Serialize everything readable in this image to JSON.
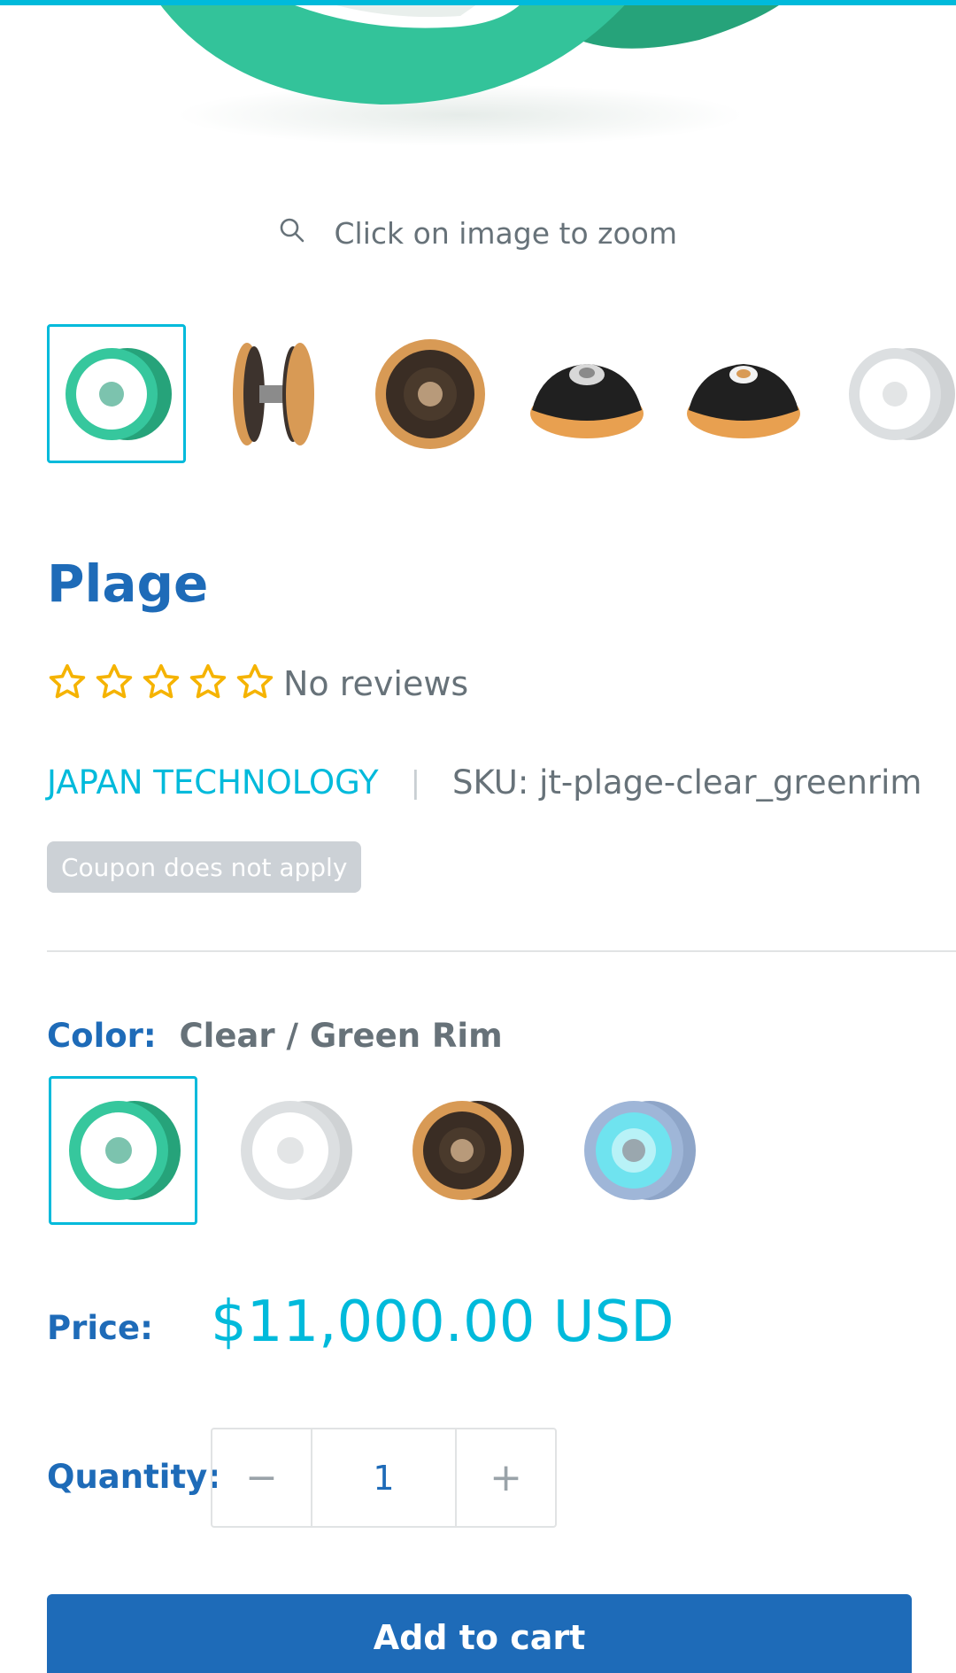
{
  "zoom_hint": {
    "label": "Click on image to zoom",
    "icon": "search-icon"
  },
  "thumbnails": [
    {
      "name": "thumb-clear-green",
      "active": true
    },
    {
      "name": "thumb-gold-side",
      "active": false
    },
    {
      "name": "thumb-gold-front",
      "active": false
    },
    {
      "name": "thumb-black-bearing",
      "active": false
    },
    {
      "name": "thumb-black-cap",
      "active": false
    },
    {
      "name": "thumb-silver",
      "active": false
    }
  ],
  "product": {
    "title": "Plage",
    "rating": {
      "stars": 0,
      "max": 5,
      "reviews_label": "No reviews"
    },
    "vendor": "JAPAN TECHNOLOGY",
    "separator": "|",
    "sku": "SKU: jt-plage-clear_greenrim",
    "coupon_badge": "Coupon does not apply"
  },
  "color": {
    "label": "Color:",
    "selected": "Clear / Green Rim",
    "swatches": [
      "Clear / Green Rim",
      "Silver",
      "Gold",
      "Blue"
    ]
  },
  "price": {
    "label": "Price:",
    "value": "$11,000.00 USD"
  },
  "quantity": {
    "label": "Quantity:",
    "value": "1",
    "decrease": "−",
    "increase": "+"
  },
  "add_to_cart": "Add to cart",
  "colors": {
    "accent": "#00badb",
    "primary": "#1e6bb8",
    "text": "#677279",
    "star": "#f5b301"
  }
}
